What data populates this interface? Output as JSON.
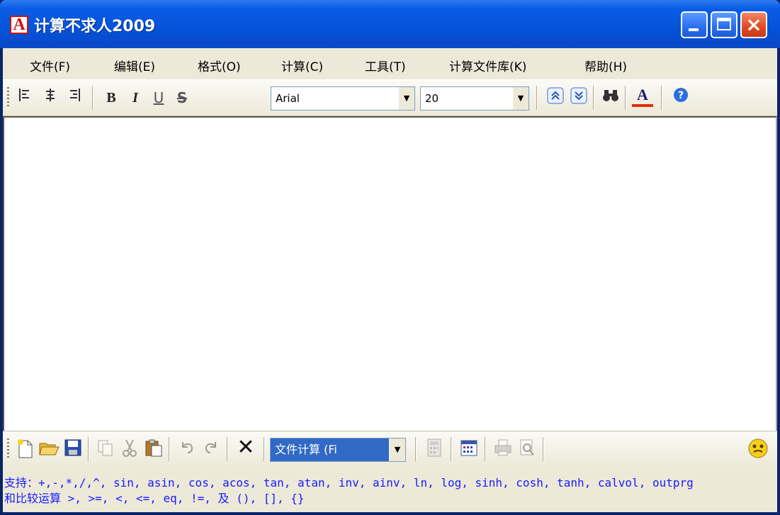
{
  "window": {
    "title": "计算不求人2009",
    "app_icon": "A"
  },
  "menu": [
    {
      "label": "文件(F)"
    },
    {
      "label": "编辑(E)"
    },
    {
      "label": "格式(O)"
    },
    {
      "label": "计算(C)"
    },
    {
      "label": "工具(T)"
    },
    {
      "label": "计算文件库(K)"
    },
    {
      "label": "帮助(H)"
    }
  ],
  "format_toolbar": {
    "font_name": "Arial",
    "font_size": "20",
    "icons": [
      "align-left-icon",
      "align-center-icon",
      "align-right-icon",
      "bold-icon",
      "italic-icon",
      "underline-icon",
      "strikethrough-icon",
      "scroll-up-icon",
      "scroll-down-icon",
      "find-icon",
      "font-color-icon",
      "help-icon"
    ],
    "bold_label": "B",
    "italic_label": "I",
    "underline_label": "U",
    "strike_label": "S",
    "fontcolor_label": "A"
  },
  "editor": {
    "content": ""
  },
  "standard_toolbar": {
    "icons": [
      "new-file-icon",
      "open-folder-icon",
      "save-icon",
      "copy-icon",
      "cut-icon",
      "paste-icon",
      "undo-icon",
      "redo-icon",
      "delete-icon",
      "calculator-icon",
      "calendar-icon",
      "print-icon",
      "print-preview-icon",
      "smiley-icon"
    ],
    "delete_label": "✕",
    "calc_mode": "文件计算 (Fi"
  },
  "status": {
    "line1": "支持：+,-,*,/,^, sin, asin, cos, acos, tan, atan, inv, ainv, ln, log, sinh, cosh, tanh, calvol, outprg",
    "line2": "和比较运算 >, >=, <, <=, eq, !=,  及 (), [], {}"
  },
  "colors": {
    "title_bar": "#0453d9",
    "chrome": "#ece9d8",
    "status_text": "#1a1aff",
    "close_button": "#e0491f"
  }
}
